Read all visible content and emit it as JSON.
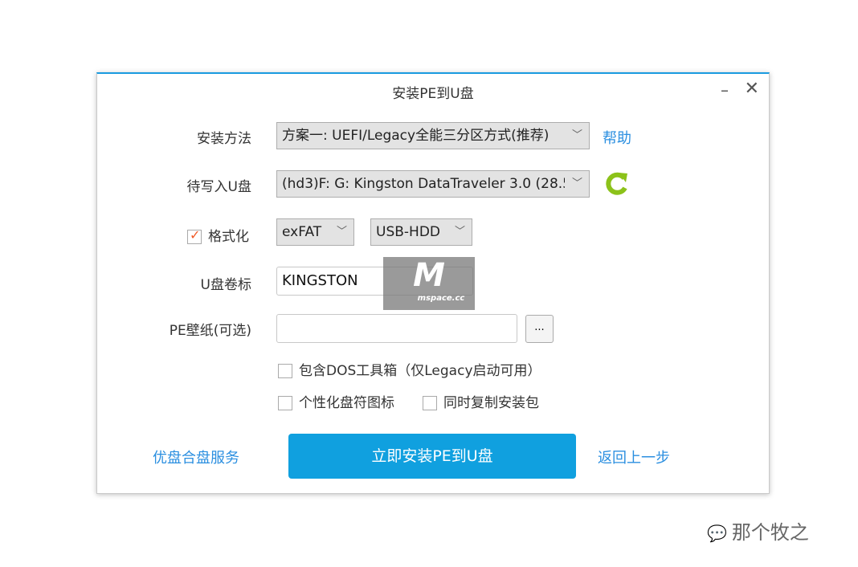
{
  "window": {
    "title": "安装PE到U盘",
    "minimize": "–",
    "close": "✕"
  },
  "form": {
    "method_label": "安装方法",
    "method_value": "方案一: UEFI/Legacy全能三分区方式(推荐)",
    "help": "帮助",
    "disk_label": "待写入U盘",
    "disk_value": "(hd3)F: G: Kingston DataTraveler 3.0 (28.5",
    "format_label": "格式化",
    "format_checked": true,
    "fs_value": "exFAT",
    "mode_value": "USB-HDD",
    "volume_label": "U盘卷标",
    "volume_value": "KINGSTON",
    "wallpaper_label": "PE壁纸(可选)",
    "wallpaper_value": "",
    "browse": "...",
    "opt_dos": "包含DOS工具箱（仅Legacy启动可用）",
    "opt_icon": "个性化盘符图标",
    "opt_copy": "同时复制安装包"
  },
  "footer": {
    "service": "优盘合盘服务",
    "install": "立即安装PE到U盘",
    "back": "返回上一步"
  },
  "watermark": {
    "logo": "M",
    "text": "mspace.cc"
  },
  "credit": "那个牧之",
  "colors": {
    "accent": "#10a0df",
    "link": "#2b8fe0",
    "check": "#f05a28",
    "refresh": "#8cc21a"
  }
}
